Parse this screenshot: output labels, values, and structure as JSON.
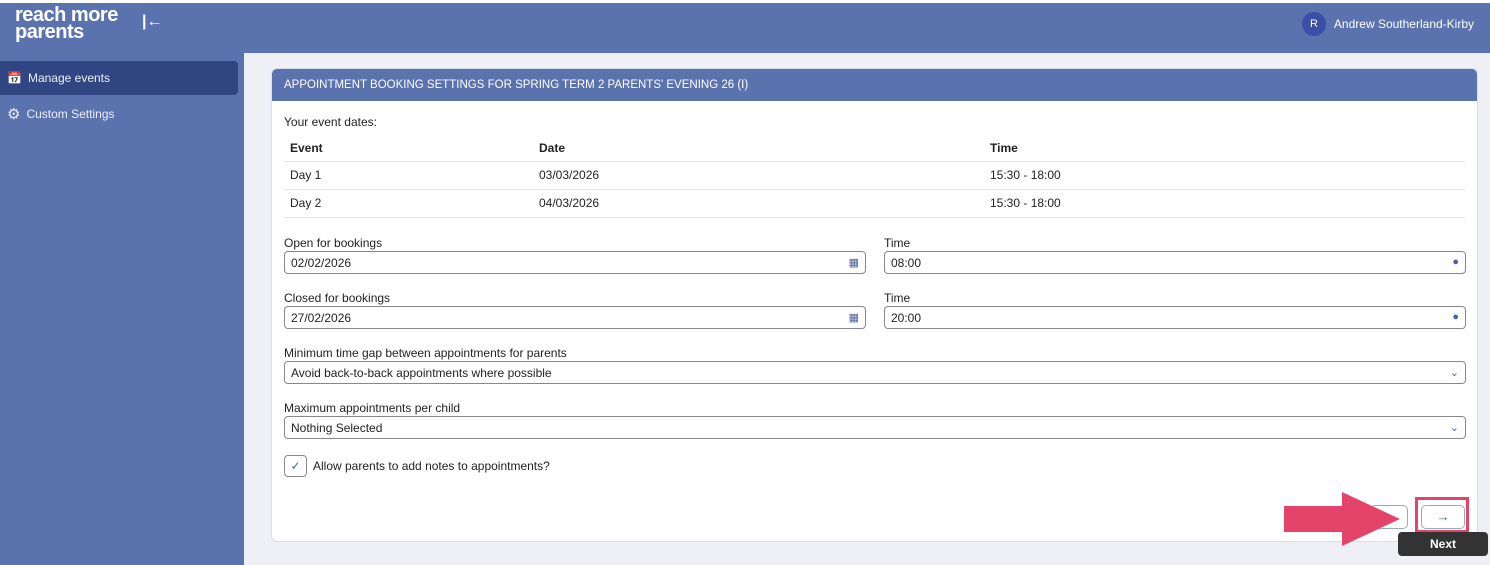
{
  "header": {
    "logo_line1": "reach more",
    "logo_line2": "parents",
    "collapse_icon": "collapse-left-icon",
    "user_initial": "R",
    "user_name": "Andrew Southerland-Kirby"
  },
  "sidebar": {
    "items": [
      {
        "label": "Manage events",
        "icon": "calendar-check-icon"
      },
      {
        "label": "Custom Settings",
        "icon": "gear-icon"
      }
    ]
  },
  "card": {
    "title": "APPOINTMENT BOOKING SETTINGS FOR SPRING TERM 2 PARENTS' EVENING 26 (I)",
    "dates_label": "Your event dates:",
    "columns": [
      "Event",
      "Date",
      "Time"
    ],
    "rows": [
      [
        "Day 1",
        "03/03/2026",
        "15:30 - 18:00"
      ],
      [
        "Day 2",
        "04/03/2026",
        "15:30 - 18:00"
      ]
    ],
    "open_label": "Open for bookings",
    "open_value": "02/02/2026",
    "open_time_label": "Time",
    "open_time": "08:00",
    "close_label": "Closed for bookings",
    "close_value": "27/02/2026",
    "close_time_label": "Time",
    "close_time": "20:00",
    "gap_label": "Minimum time gap between appointments for parents",
    "gap_value": "Avoid back-to-back appointments where possible",
    "max_label": "Maximum appointments per child",
    "max_value": "Nothing Selected",
    "notes_label": "Allow parents to add notes to appointments?",
    "notes_checked": true
  },
  "next_tooltip": "Next",
  "colors": {
    "brand": "#5a72ad",
    "active": "#2f4682",
    "annotation": "#e4436a"
  }
}
